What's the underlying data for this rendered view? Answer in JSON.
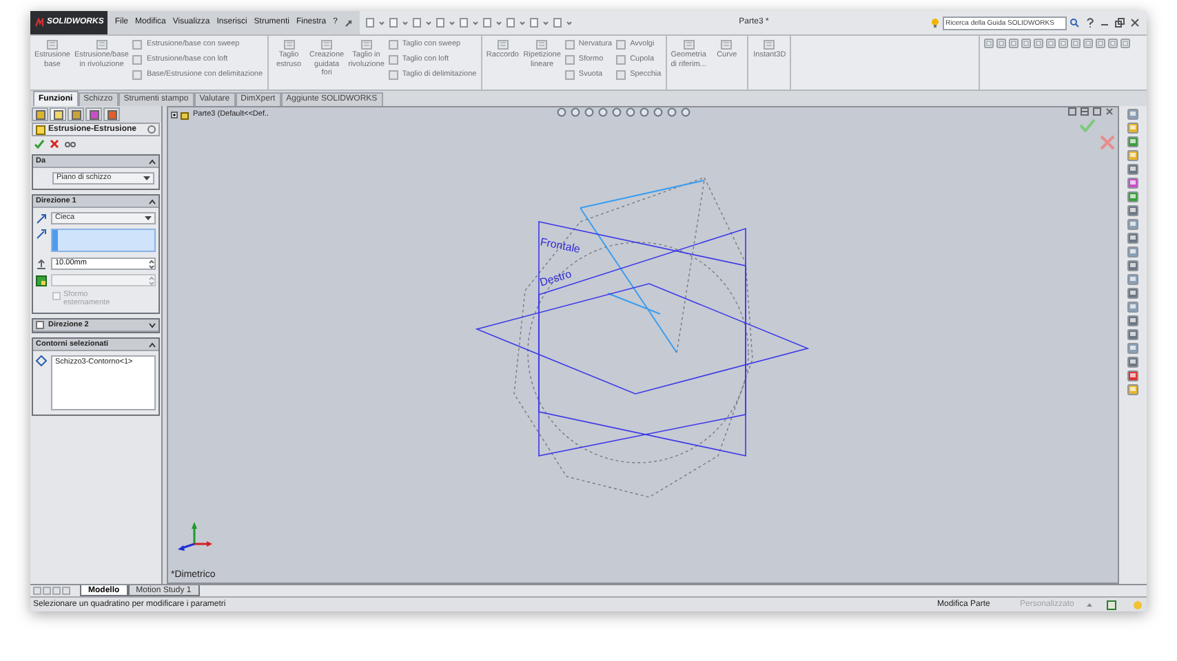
{
  "title_bar": {
    "logo": "SOLIDWORKS",
    "menu": [
      "File",
      "Modifica",
      "Visualizza",
      "Inserisci",
      "Strumenti",
      "Finestra",
      "?"
    ],
    "title": "Parte3 *",
    "search": {
      "placeholder": "Ricerca della Guida SOLIDWORKS"
    }
  },
  "ribbon": {
    "groups": [
      {
        "columns": [
          {
            "kind": "large",
            "label": "Estrusione base"
          },
          {
            "kind": "large",
            "label": "Estrusione/base in rivoluzione"
          },
          {
            "kind": "stack",
            "items": [
              "Estrusione/base con sweep",
              "Estrusione/base con loft",
              "Base/Estrusione con delimitazione"
            ]
          }
        ]
      },
      {
        "columns": [
          {
            "kind": "large",
            "label": "Taglio estruso"
          },
          {
            "kind": "large",
            "label": "Creazione guidata fori"
          },
          {
            "kind": "large",
            "label": "Taglio in rivoluzione"
          },
          {
            "kind": "stack",
            "items": [
              "Taglio con sweep",
              "Taglio con loft",
              "Taglio di delimitazione"
            ]
          }
        ]
      },
      {
        "columns": [
          {
            "kind": "large",
            "label": "Raccordo"
          },
          {
            "kind": "large",
            "label": "Ripetizione lineare"
          },
          {
            "kind": "stack",
            "items": [
              "Nervatura",
              "Sformo",
              "Svuota"
            ]
          },
          {
            "kind": "stack",
            "items": [
              "Avvolgi",
              "Cupola",
              "Specchia"
            ]
          }
        ]
      },
      {
        "columns": [
          {
            "kind": "large",
            "label": "Geometria di riferim..."
          },
          {
            "kind": "large",
            "label": "Curve"
          }
        ]
      },
      {
        "columns": [
          {
            "kind": "large",
            "label": "Instant3D"
          }
        ]
      }
    ]
  },
  "tabs": [
    {
      "label": "Funzioni",
      "selected": true
    },
    {
      "label": "Schizzo",
      "selected": false
    },
    {
      "label": "Strumenti stampo",
      "selected": false
    },
    {
      "label": "Valutare",
      "selected": false
    },
    {
      "label": "DimXpert",
      "selected": false
    },
    {
      "label": "Aggiunte SOLIDWORKS",
      "selected": false
    }
  ],
  "property_manager": {
    "title": "Estrusione-Estrusione",
    "sections": [
      {
        "kind": "from",
        "title": "Da",
        "dropdown": "Piano di schizzo"
      },
      {
        "kind": "direction",
        "title": "Direzione 1",
        "dropdown": "Cieca",
        "depth": "10.00mm",
        "checkbox": {
          "label": "Sformo esternamente",
          "checked": false,
          "disabled": true
        }
      },
      {
        "kind": "collapsed",
        "title": "Direzione 2",
        "checked": false
      },
      {
        "kind": "list",
        "title": "Contorni selezionati",
        "items": [
          "Schizzo3-Contorno<1>"
        ]
      }
    ]
  },
  "graphics": {
    "tree_item": "Parte3 (Default<<Def..",
    "view_label": "*Dimetrico",
    "planes": [
      "Frontale",
      "Destro"
    ]
  },
  "bottom_tabs": [
    {
      "label": "Modello",
      "selected": true
    },
    {
      "label": "Motion Study 1",
      "selected": false
    }
  ],
  "status_bar": {
    "message": "Selezionare un quadratino per modificare i parametri",
    "mode": "Modifica Parte",
    "units": "Personalizzato"
  }
}
